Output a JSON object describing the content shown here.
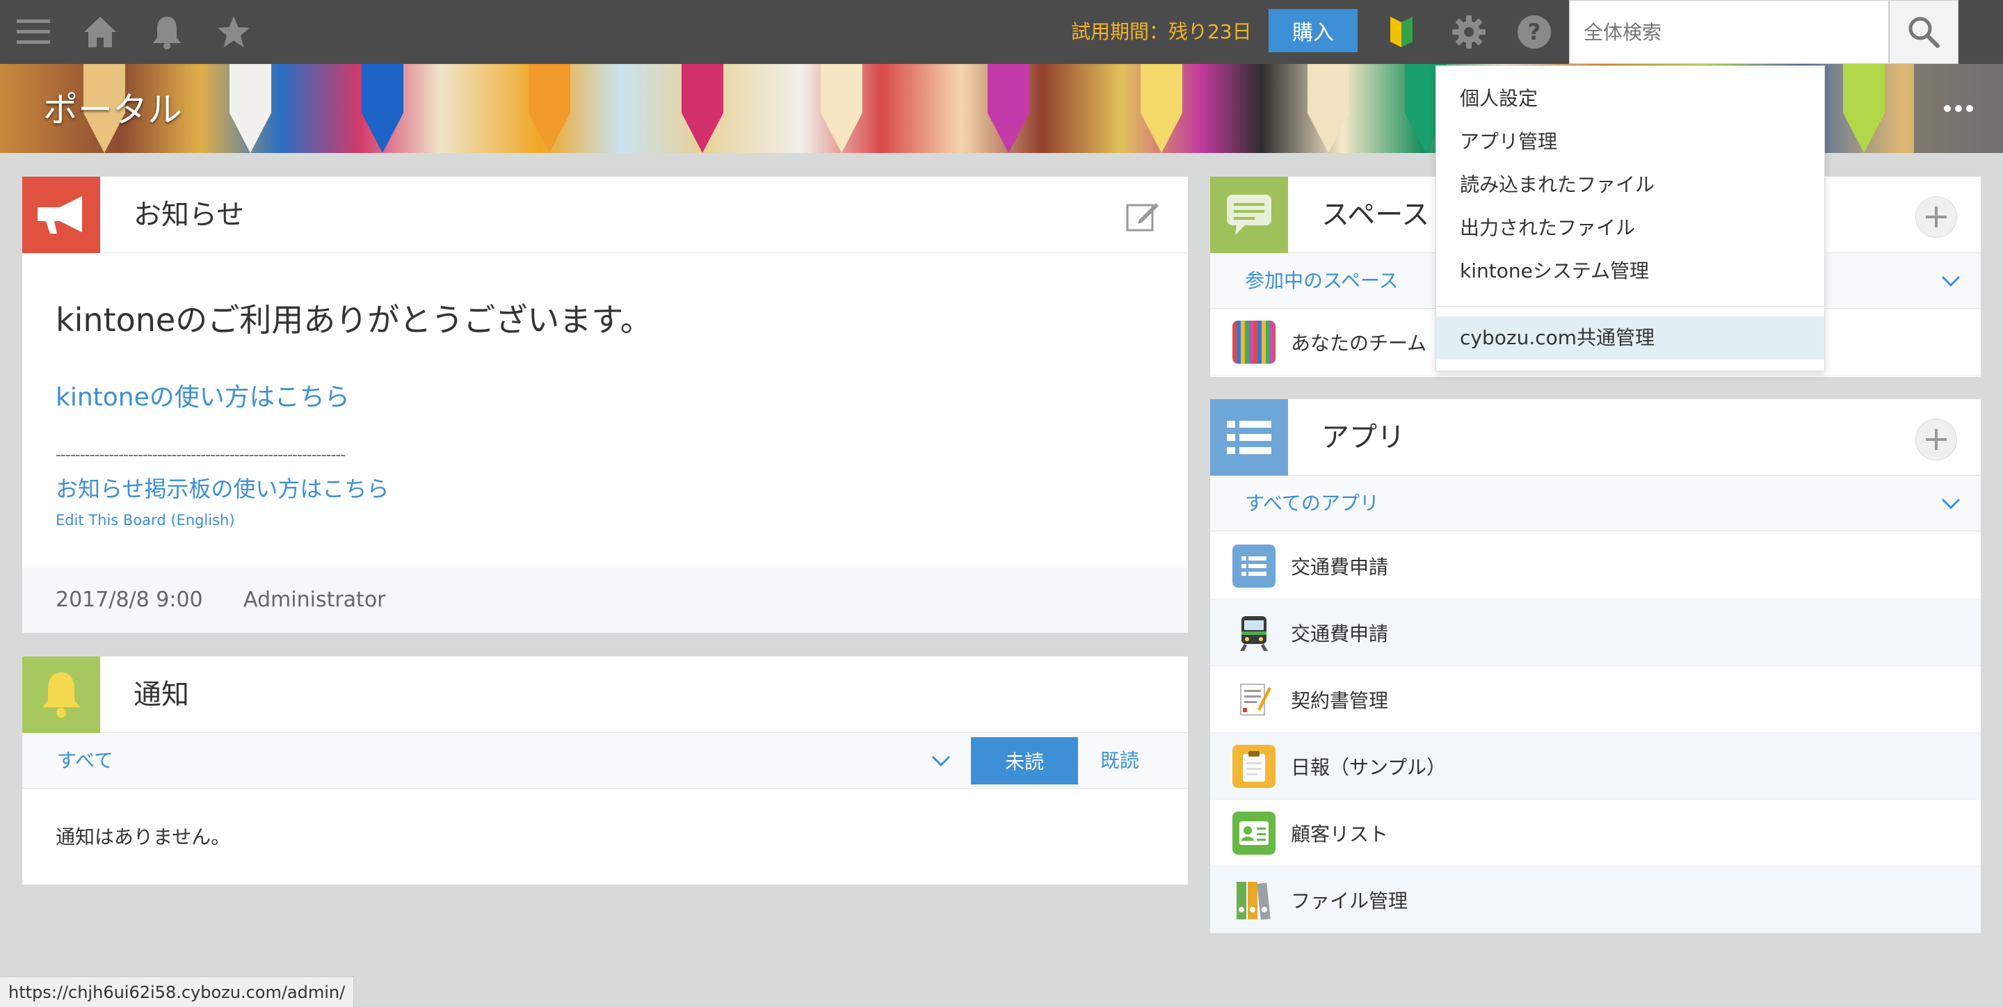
{
  "topbar": {
    "trial_text": "試用期間：残り23日",
    "buy_label": "購入",
    "search_placeholder": "全体検索",
    "trial_color": "#f0b429",
    "accent_color": "#3d8fd6",
    "icons": [
      "menu-icon",
      "home-icon",
      "bell-icon",
      "star-icon",
      "beginner-mark-icon",
      "gear-icon",
      "help-icon",
      "search-icon"
    ]
  },
  "banner": {
    "title": "ポータル"
  },
  "dropdown": {
    "items": [
      {
        "label": "個人設定"
      },
      {
        "label": "アプリ管理"
      },
      {
        "label": "読み込まれたファイル"
      },
      {
        "label": "出力されたファイル"
      },
      {
        "label": "kintoneシステム管理"
      },
      {
        "label": "cybozu.com共通管理"
      }
    ]
  },
  "announcement": {
    "title": "お知らせ",
    "headline": "kintoneのご利用ありがとうございます。",
    "howto_link": "kintoneの使い方はこちら",
    "divider": "------------------------------------------------------------",
    "board_link": "お知らせ掲示板の使い方はこちら",
    "edit_link": "Edit This Board (English)",
    "date": "2017/8/8 9:00",
    "author": "Administrator"
  },
  "notifications": {
    "title": "通知",
    "filter": "すべて",
    "unread_tab": "未読",
    "read_tab": "既読",
    "empty_text": "通知はありません。"
  },
  "spaces": {
    "title": "スペース",
    "filter": "参加中のスペース",
    "items": [
      {
        "name": "あなたのチーム"
      }
    ]
  },
  "apps": {
    "title": "アプリ",
    "filter": "すべてのアプリ",
    "items": [
      {
        "name": "交通費申請",
        "icon": "list-icon"
      },
      {
        "name": "交通費申請",
        "icon": "train-icon"
      },
      {
        "name": "契約書管理",
        "icon": "contract-icon"
      },
      {
        "name": "日報（サンプル）",
        "icon": "clipboard-icon"
      },
      {
        "name": "顧客リスト",
        "icon": "contact-card-icon"
      },
      {
        "name": "ファイル管理",
        "icon": "binders-icon"
      }
    ]
  },
  "statusbar": {
    "url": "https://chjh6ui62i58.cybozu.com/admin/"
  }
}
